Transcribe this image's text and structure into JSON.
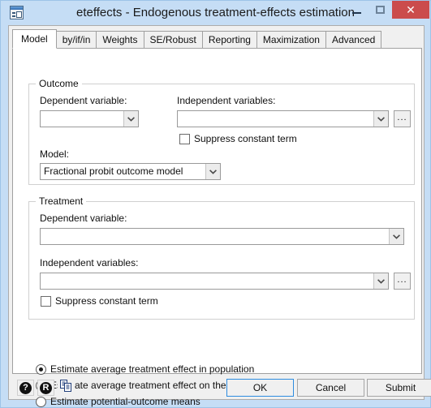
{
  "window": {
    "title": "eteffects - Endogenous treatment-effects estimation",
    "icon": "dialog-form-icon",
    "minimize_label": "–",
    "maximize_label": "□",
    "close_label": "✕"
  },
  "tabs": [
    {
      "label": "Model",
      "active": true
    },
    {
      "label": "by/if/in",
      "active": false
    },
    {
      "label": "Weights",
      "active": false
    },
    {
      "label": "SE/Robust",
      "active": false
    },
    {
      "label": "Reporting",
      "active": false
    },
    {
      "label": "Maximization",
      "active": false
    },
    {
      "label": "Advanced",
      "active": false
    }
  ],
  "outcome": {
    "group_title": "Outcome",
    "dependent_label": "Dependent variable:",
    "dependent_value": "",
    "independent_label": "Independent variables:",
    "independent_value": "",
    "browse_label": "...",
    "suppress_label": "Suppress constant term",
    "suppress_checked": false,
    "model_label": "Model:",
    "model_value": "Fractional probit outcome model"
  },
  "treatment": {
    "group_title": "Treatment",
    "dependent_label": "Dependent variable:",
    "dependent_value": "",
    "independent_label": "Independent variables:",
    "independent_value": "",
    "browse_label": "...",
    "suppress_label": "Suppress constant term",
    "suppress_checked": false
  },
  "estimands": [
    {
      "label": "Estimate average treatment effect in population",
      "checked": true
    },
    {
      "label": "Estimate average treatment effect on the treated",
      "checked": false
    },
    {
      "label": "Estimate potential-outcome means",
      "checked": false
    }
  ],
  "bottom": {
    "help_icon": "help-question-icon",
    "help_glyph": "?",
    "reset_icon": "reset-r-icon",
    "reset_glyph": "R",
    "copy_icon": "copy-clipboard-icon",
    "ok_label": "OK",
    "cancel_label": "Cancel",
    "submit_label": "Submit"
  },
  "colors": {
    "titlebar": "#c5ddf5",
    "close_button": "#cb4c4c",
    "dialog_face": "#f0f0f0",
    "tabpage": "#ffffff",
    "default_button_border": "#2d8ce0"
  }
}
